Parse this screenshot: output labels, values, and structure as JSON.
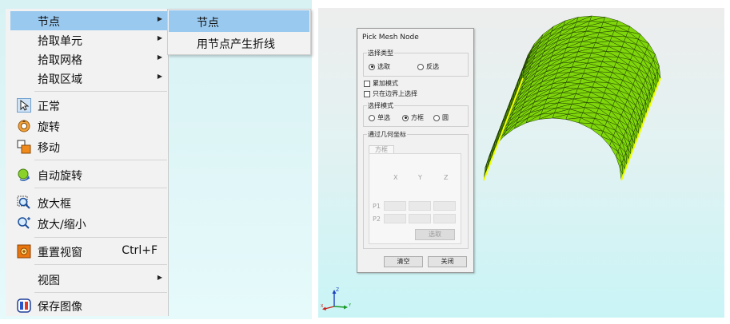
{
  "context_menu": {
    "items": [
      {
        "label": "节点",
        "submenu": true
      },
      {
        "label": "拾取单元",
        "submenu": true
      },
      {
        "label": "拾取网格",
        "submenu": true
      },
      {
        "label": "拾取区域",
        "submenu": true
      },
      {
        "label": "正常",
        "icon": "cursor-arrow-icon"
      },
      {
        "label": "旋转",
        "icon": "rotate-icon"
      },
      {
        "label": "移动",
        "icon": "move-icon"
      },
      {
        "label": "自动旋转",
        "icon": "auto-rotate-icon"
      },
      {
        "label": "放大框",
        "icon": "zoom-box-icon"
      },
      {
        "label": "放大/缩小",
        "icon": "zoom-in-out-icon"
      },
      {
        "label": "重置视窗",
        "icon": "reset-view-icon",
        "shortcut": "Ctrl+F"
      },
      {
        "label": "视图",
        "submenu": true
      },
      {
        "label": "保存图像",
        "icon": "save-image-icon"
      }
    ],
    "submenu_items": [
      {
        "label": "节点"
      },
      {
        "label": "用节点产生折线"
      }
    ]
  },
  "dialog": {
    "title": "Pick Mesh Node",
    "select_type": {
      "group_label": "选择类型",
      "options": [
        "选取",
        "反选"
      ],
      "selected": "选取"
    },
    "checkboxes": [
      "累加模式",
      "只在边界上选择"
    ],
    "select_mode": {
      "group_label": "选择模式",
      "options": [
        "单选",
        "方框",
        "圆"
      ],
      "selected": "方框"
    },
    "geometry": {
      "group_label": "通过几何坐标",
      "tab": "方框",
      "column_headers": [
        "X",
        "Y",
        "Z"
      ],
      "row_labels": [
        "P1",
        "P2"
      ],
      "pick_button": "选取"
    },
    "clear_button": "清空",
    "close_button": "关闭"
  },
  "axis_labels": {
    "z": "Z",
    "x": "X",
    "y": "Y"
  },
  "colors": {
    "menu_highlight": "#99c9ef",
    "mesh_fill": "#7fd60a",
    "mesh_edge": "#eeff00",
    "viewport_bottom": "#c9f4f6"
  }
}
